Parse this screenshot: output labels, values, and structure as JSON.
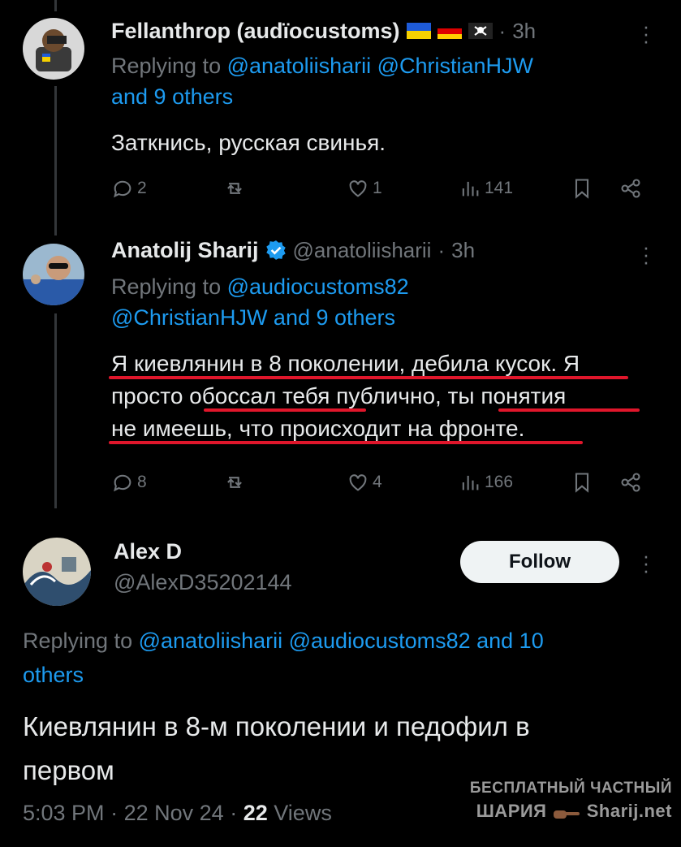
{
  "tweets": [
    {
      "name": "Fellanthrop (audïocustoms)",
      "flags": [
        "ukraine-flag",
        "germany-flag",
        "pirate-flag"
      ],
      "time": "3h",
      "replying_prefix": "Replying to",
      "replying_handles": "@anatoliisharii @ChristianHJW",
      "replying_more": "and 9 others",
      "text": "Заткнись, русская свинья.",
      "replies": "2",
      "reposts": "",
      "likes": "1",
      "views": "141"
    },
    {
      "name": "Anatolij Sharij",
      "verified": true,
      "handle": "@anatoliisharii",
      "time": "3h",
      "replying_prefix": "Replying to",
      "replying_line1": "@audiocustoms82",
      "replying_line2": "@ChristianHJW and 9 others",
      "text_line1": "Я киевлянин в 8 поколении, дебила кусок. Я",
      "text_line2": "просто обоссал тебя публично, ты понятия",
      "text_line3": "не имеешь, что происходит на фронте.",
      "replies": "8",
      "reposts": "",
      "likes": "4",
      "views": "166"
    }
  ],
  "main": {
    "name": "Alex D",
    "handle": "@AlexD35202144",
    "follow_label": "Follow",
    "replying_prefix": "Replying to",
    "replying_handles": "@anatoliisharii @audiocustoms82 and 10",
    "replying_more": "others",
    "text_line1": "Киевлянин в 8-м поколении и педофил в",
    "text_line2": "первом",
    "time": "5:03 PM",
    "date": "22 Nov 24",
    "views_count": "22",
    "views_label": "Views"
  },
  "watermark": {
    "line1": "БЕСПЛАТНЫЙ ЧАСТНЫЙ",
    "line2_left": "ШАРИЯ",
    "line2_right": "Sharij.net"
  },
  "colors": {
    "background": "#000000",
    "text": "#e7e9ea",
    "muted": "#71767b",
    "link": "#1d9bf0",
    "underline": "#e0162b",
    "follow_bg": "#eff3f4"
  }
}
